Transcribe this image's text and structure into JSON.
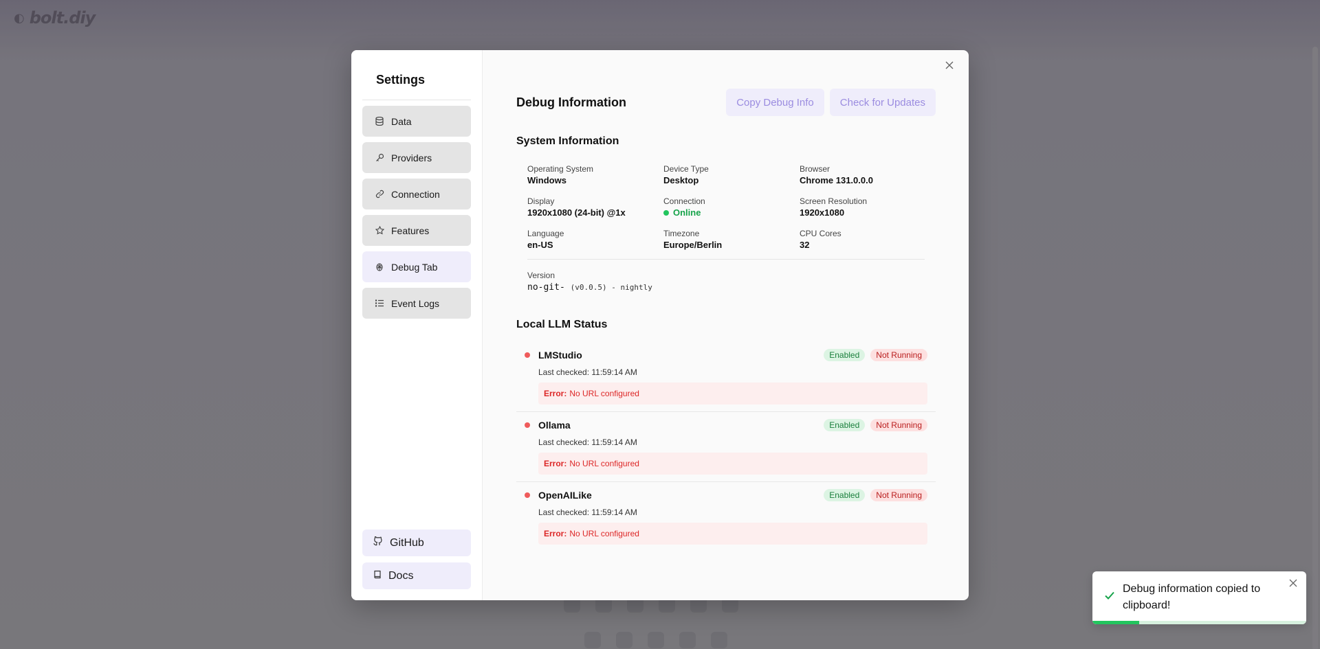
{
  "background": {
    "logo": "bolt.diy"
  },
  "sidebar": {
    "title": "Settings",
    "items": [
      {
        "label": "Data",
        "icon": "database-icon"
      },
      {
        "label": "Providers",
        "icon": "key-icon"
      },
      {
        "label": "Connection",
        "icon": "link-icon"
      },
      {
        "label": "Features",
        "icon": "star-icon"
      },
      {
        "label": "Debug Tab",
        "icon": "bug-icon",
        "active": true
      },
      {
        "label": "Event Logs",
        "icon": "list-icon"
      }
    ],
    "links": [
      {
        "label": "GitHub",
        "icon": "github-icon"
      },
      {
        "label": "Docs",
        "icon": "book-icon"
      }
    ]
  },
  "main": {
    "title": "Debug Information",
    "copy_button": "Copy Debug Info",
    "update_button": "Check for Updates",
    "system_info": {
      "title": "System Information",
      "fields": [
        {
          "label": "Operating System",
          "value": "Windows"
        },
        {
          "label": "Device Type",
          "value": "Desktop"
        },
        {
          "label": "Browser",
          "value": "Chrome 131.0.0.0"
        },
        {
          "label": "Display",
          "value": "1920x1080 (24-bit) @1x"
        },
        {
          "label": "Connection",
          "value": "Online"
        },
        {
          "label": "Screen Resolution",
          "value": "1920x1080"
        },
        {
          "label": "Language",
          "value": "en-US"
        },
        {
          "label": "Timezone",
          "value": "Europe/Berlin"
        },
        {
          "label": "CPU Cores",
          "value": "32"
        }
      ],
      "version_label": "Version",
      "version_value": "no-git-",
      "version_detail": "(v0.0.5) - nightly"
    },
    "llm_status": {
      "title": "Local LLM Status",
      "items": [
        {
          "name": "LMStudio",
          "enabled": "Enabled",
          "running": "Not Running",
          "last_checked": "Last checked: 11:59:14 AM",
          "error_label": "Error:",
          "error_text": "No URL configured"
        },
        {
          "name": "Ollama",
          "enabled": "Enabled",
          "running": "Not Running",
          "last_checked": "Last checked: 11:59:14 AM",
          "error_label": "Error:",
          "error_text": "No URL configured"
        },
        {
          "name": "OpenAILike",
          "enabled": "Enabled",
          "running": "Not Running",
          "last_checked": "Last checked: 11:59:14 AM",
          "error_label": "Error:",
          "error_text": "No URL configured"
        }
      ]
    }
  },
  "toast": {
    "message": "Debug information copied to clipboard!",
    "progress": 0.22
  },
  "colors": {
    "accent": "#9b8ce0",
    "online": "#16a34a",
    "error": "#dc2626",
    "status_dot_red": "#ef5b5b"
  }
}
